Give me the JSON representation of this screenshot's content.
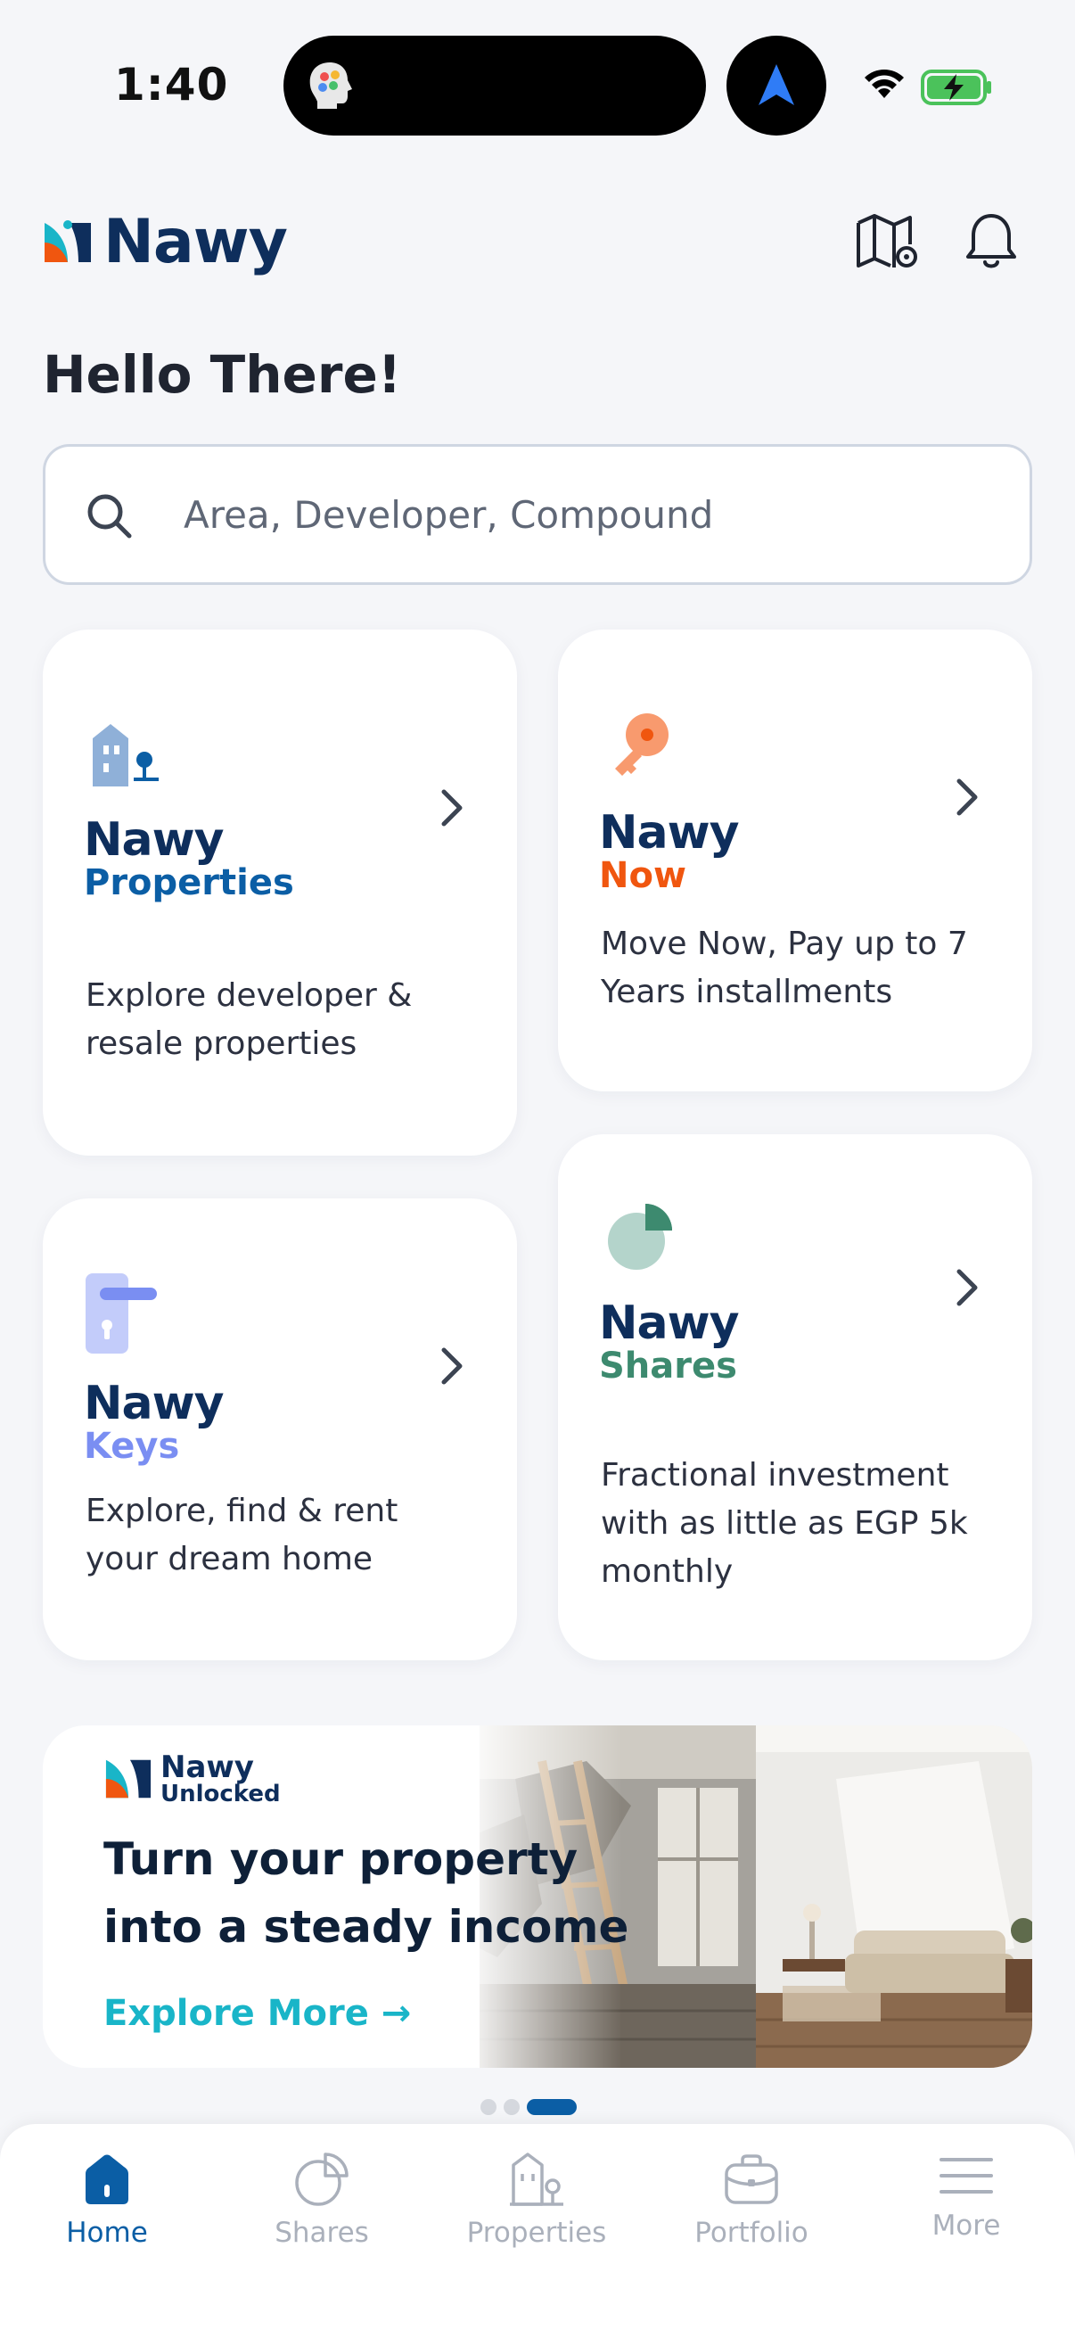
{
  "status_bar": {
    "time": "1:40"
  },
  "header": {
    "brand": "Nawy"
  },
  "greeting": "Hello There!",
  "search": {
    "placeholder": "Area, Developer, Compound"
  },
  "cards": {
    "properties": {
      "brand": "Nawy",
      "product": "Properties",
      "description": "Explore developer & resale properties"
    },
    "now": {
      "brand": "Nawy",
      "product": "Now",
      "description": "Move Now, Pay up to 7 Years installments"
    },
    "keys": {
      "brand": "Nawy",
      "product": "Keys",
      "description": "Explore, find & rent your dream home"
    },
    "shares": {
      "brand": "Nawy",
      "product": "Shares",
      "description": "Fractional investment with as little as EGP 5k monthly"
    }
  },
  "banner": {
    "brand": "Nawy",
    "product": "Unlocked",
    "headline": "Turn your property into a steady income",
    "cta": "Explore More →"
  },
  "carousel": {
    "count": 3,
    "active_index": 2
  },
  "bottom_nav": [
    {
      "label": "Home",
      "icon": "home-icon",
      "active": true
    },
    {
      "label": "Shares",
      "icon": "pie-chart-icon",
      "active": false
    },
    {
      "label": "Properties",
      "icon": "building-icon",
      "active": false
    },
    {
      "label": "Portfolio",
      "icon": "briefcase-icon",
      "active": false
    },
    {
      "label": "More",
      "icon": "menu-icon",
      "active": false
    }
  ],
  "colors": {
    "brand_navy": "#0e2e5c",
    "properties_blue": "#0b5ea5",
    "now_orange": "#f0560f",
    "keys_purple": "#7a8ef2",
    "shares_green": "#3d8a6f",
    "cta_teal": "#19b5c8"
  }
}
